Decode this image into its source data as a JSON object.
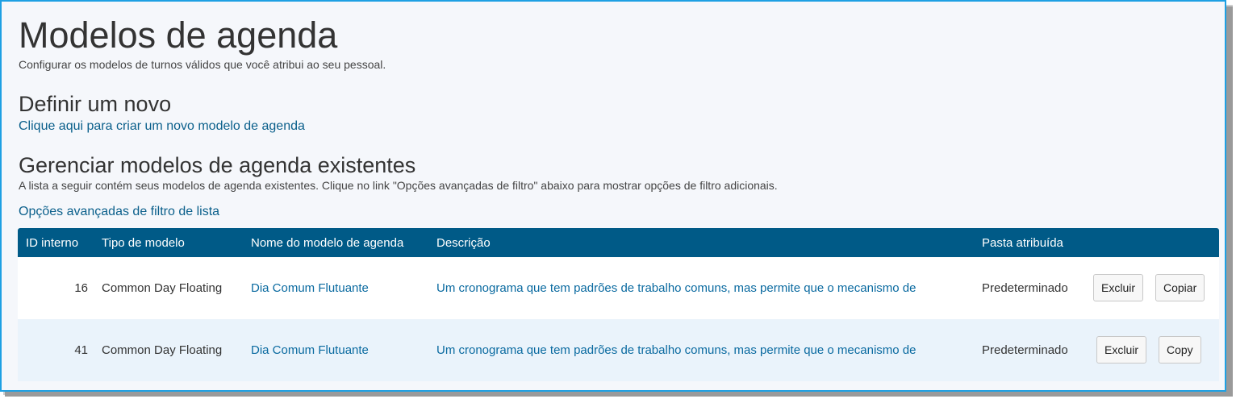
{
  "page": {
    "title": "Modelos de agenda",
    "subtitle": "Configurar os modelos de turnos válidos que você atribui ao seu pessoal."
  },
  "define": {
    "heading": "Definir um novo",
    "link": "Clique aqui para criar um novo modelo de agenda"
  },
  "manage": {
    "heading": "Gerenciar modelos de agenda existentes",
    "description": "A lista a seguir contém seus modelos de agenda existentes. Clique no link \"Opções avançadas de filtro\" abaixo para mostrar opções de filtro adicionais.",
    "filter_link": "Opções avançadas de filtro de lista"
  },
  "table": {
    "headers": [
      "ID interno",
      "Tipo de modelo",
      "Nome do modelo de agenda",
      "Descrição",
      "Pasta atribuída"
    ],
    "rows": [
      {
        "id": "16",
        "type": "Common Day Floating",
        "name": "Dia Comum Flutuante",
        "description": "Um cronograma que tem padrões de trabalho comuns, mas permite que o mecanismo de",
        "folder": "Predeterminado",
        "delete_label": "Excluir",
        "copy_label": "Copiar"
      },
      {
        "id": "41",
        "type": "Common Day Floating",
        "name": "Dia Comum Flutuante",
        "description": "Um cronograma que tem padrões de trabalho comuns, mas permite que o mecanismo de",
        "folder": "Predeterminado",
        "delete_label": "Excluir",
        "copy_label": "Copy"
      }
    ]
  },
  "colors": {
    "header_bg": "#005a87",
    "link": "#0a5f8b",
    "frame_border": "#1ea0e3",
    "alt_row": "#eaf3fb"
  }
}
